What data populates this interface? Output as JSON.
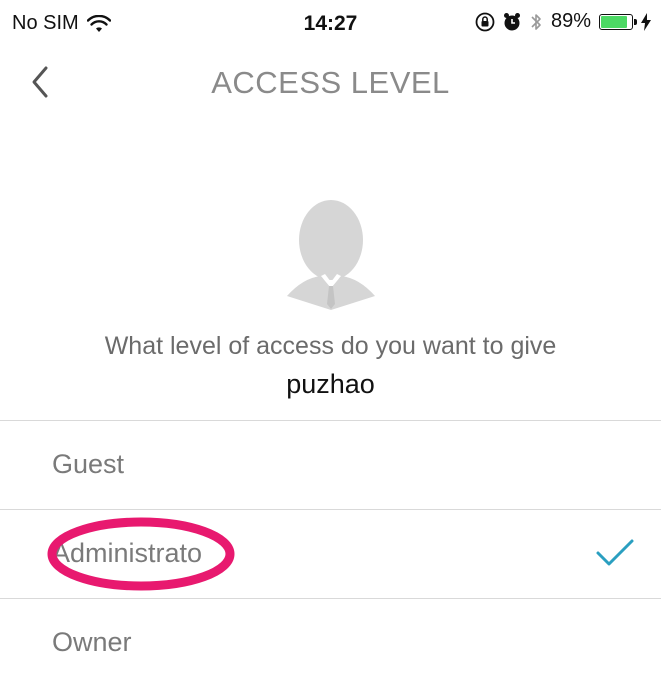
{
  "status_bar": {
    "carrier": "No SIM",
    "time": "14:27",
    "battery_percent": "89%",
    "battery_level": 0.89,
    "battery_color": "#4cd964",
    "icons": [
      "wifi-icon",
      "orientation-lock-icon",
      "alarm-icon",
      "bluetooth-icon",
      "battery-icon",
      "charging-bolt-icon"
    ]
  },
  "nav": {
    "title": "ACCESS LEVEL",
    "back_icon": "chevron-left-icon"
  },
  "prompt": {
    "text": "What level of access do you want to give",
    "user_name": "puzhao"
  },
  "options": [
    {
      "label": "Guest",
      "selected": false
    },
    {
      "label": "Administrato",
      "selected": true
    },
    {
      "label": "Owner",
      "selected": false
    }
  ],
  "colors": {
    "accent_check": "#2a9fc0",
    "annotation": "#e8196f",
    "title_gray": "#8a8a8a"
  }
}
